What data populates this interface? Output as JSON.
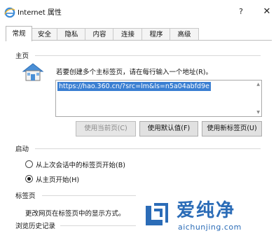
{
  "window": {
    "title": "Internet 属性",
    "help_symbol": "?",
    "close_symbol": "✕"
  },
  "tabs": [
    {
      "label": "常规",
      "active": true
    },
    {
      "label": "安全"
    },
    {
      "label": "隐私"
    },
    {
      "label": "内容"
    },
    {
      "label": "连接"
    },
    {
      "label": "程序"
    },
    {
      "label": "高级"
    }
  ],
  "home": {
    "heading": "主页",
    "description": "若要创建多个主标签页，请在每行输入一个地址(R)。",
    "url": "https://hao.360.cn/?src=lm&ls=n5a04abfd9e",
    "buttons": {
      "use_current": "使用当前页(C)",
      "use_default": "使用默认值(F)",
      "use_new_tab": "使用新标签页(U)"
    }
  },
  "startup": {
    "heading": "启动",
    "options": [
      {
        "label": "从上次会话中的标签页开始(B)",
        "checked": false
      },
      {
        "label": "从主页开始(H)",
        "checked": true
      }
    ]
  },
  "tabs_section": {
    "heading": "标签页",
    "description": "更改网页在标签页中的显示方式。"
  },
  "history": {
    "heading": "浏览历史记录"
  },
  "watermark": {
    "name": "爱纯净",
    "url": "aichunjing.com"
  },
  "colors": {
    "selection": "#3a7fd2",
    "watermark": "#2b6cb7"
  }
}
